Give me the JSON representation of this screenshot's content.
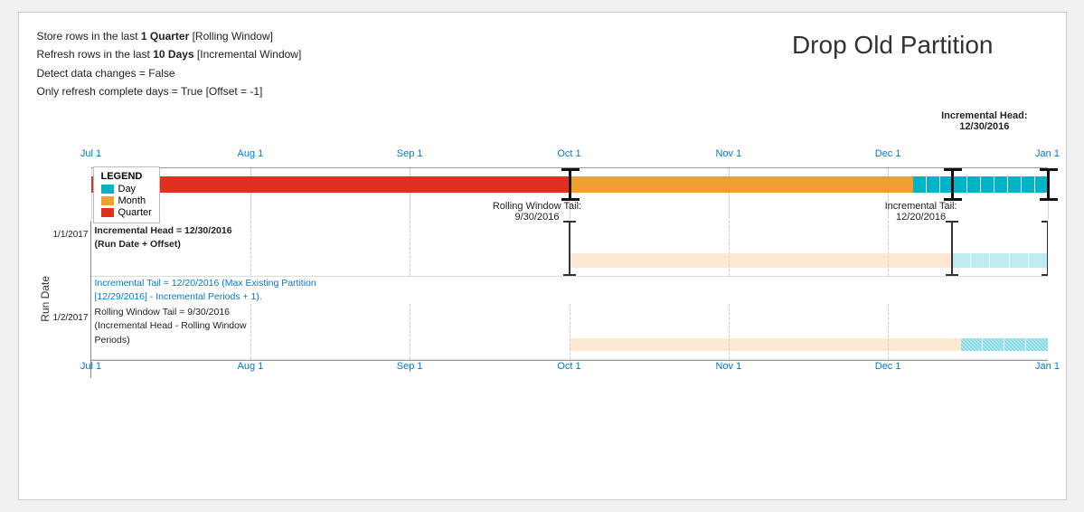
{
  "title": "Drop Old Partition",
  "info": {
    "line1_pre": "Store rows in the last ",
    "line1_bold": "1 Quarter",
    "line1_post": " [Rolling Window]",
    "line2_pre": "Refresh rows in the last ",
    "line2_bold": "10 Days",
    "line2_post": " [Incremental Window]",
    "line3": "Detect data changes = False",
    "line4": "Only refresh complete days = True [Offset = -1]"
  },
  "axis_labels": [
    "Jul 1",
    "Aug 1",
    "Sep 1",
    "Oct 1",
    "Nov 1",
    "Dec 1",
    "Jan 1"
  ],
  "legend": {
    "title": "LEGEND",
    "items": [
      {
        "label": "Day",
        "color": "#00b4c8"
      },
      {
        "label": "Month",
        "color": "#f0a030"
      },
      {
        "label": "Quarter",
        "color": "#e03020"
      }
    ]
  },
  "incremental_head_label": "Incremental Head:\n12/30/2016",
  "rolling_window_tail_label": "Rolling Window Tail:\n9/30/2016",
  "incremental_tail_label": "Incremental Tail:\n12/20/2016",
  "run_date_label": "Run Date",
  "run_dates": [
    "1/1/2017",
    "1/2/2017"
  ],
  "description": {
    "head": "Incremental Head = 12/30/2016\n(Run Date + Offset)",
    "tail": "Incremental Tail = 12/20/2016 (Max Existing Partition [12/29/2016] -\nIncremental Periods + 1).",
    "rolling": "Rolling Window Tail = 9/30/2016\n(Incremental Head - Rolling Window\nPeriods)"
  }
}
